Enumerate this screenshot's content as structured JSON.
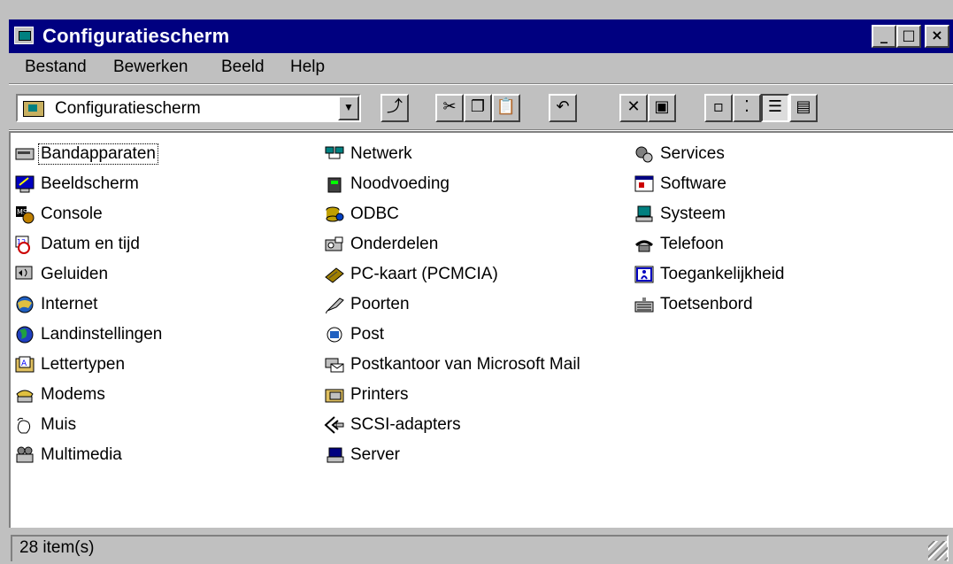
{
  "window": {
    "title": "Configuratiescherm",
    "controls": {
      "minimize": "_",
      "maximize": "□",
      "close": "×"
    }
  },
  "menu": [
    {
      "label": "Bestand"
    },
    {
      "label": "Bewerken"
    },
    {
      "label": "Beeld"
    },
    {
      "label": "Help"
    }
  ],
  "toolbar": {
    "address_value": "Configuratiescherm",
    "buttons": [
      {
        "name": "up-folder-icon"
      },
      {
        "name": "cut-icon"
      },
      {
        "name": "copy-icon"
      },
      {
        "name": "paste-icon"
      },
      {
        "name": "undo-icon"
      },
      {
        "name": "delete-icon"
      },
      {
        "name": "properties-icon"
      },
      {
        "name": "large-icons-icon"
      },
      {
        "name": "small-icons-icon"
      },
      {
        "name": "list-view-icon"
      },
      {
        "name": "details-view-icon"
      }
    ]
  },
  "items": {
    "col1": [
      "Bandapparaten",
      "Beeldscherm",
      "Console",
      "Datum en tijd",
      "Geluiden",
      "Internet",
      "Landinstellingen",
      "Lettertypen",
      "Modems",
      "Muis",
      "Multimedia"
    ],
    "col2": [
      "Netwerk",
      "Noodvoeding",
      "ODBC",
      "Onderdelen",
      "PC-kaart (PCMCIA)",
      "Poorten",
      "Post",
      "Postkantoor van Microsoft Mail",
      "Printers",
      "SCSI-adapters",
      "Server"
    ],
    "col3": [
      "Services",
      "Software",
      "Systeem",
      "Telefoon",
      "Toegankelijkheid",
      "Toetsenbord"
    ]
  },
  "status": {
    "text": "28 item(s)"
  }
}
